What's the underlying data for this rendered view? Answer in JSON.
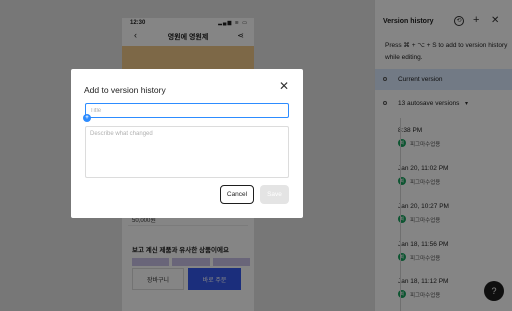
{
  "canvas": {
    "frame_label": "",
    "status_time": "12:30",
    "status_icons": "▂▄▆ ≋ ▭",
    "app_title": "영원에 영원제",
    "price": "50,000원",
    "related_heading": "보고 계신 제품과 유사한 상품이에요",
    "cart_label": "장바구니",
    "buy_label": "바로 주문",
    "colors": {
      "buy_button": "#3558ee",
      "product_image": "#f0c888"
    }
  },
  "panel": {
    "title": "Version history",
    "shortcut_hint": "Press ⌘ + ⌥ + S to add to version history while editing.",
    "current_version_label": "Current version",
    "autosave_label": "13 autosave versions",
    "versions": [
      {
        "time": "8:38 PM",
        "avatar": "피",
        "author": "피그마수업용"
      },
      {
        "time": "Jan 20, 11:02 PM",
        "avatar": "피",
        "author": "피그마수업용"
      },
      {
        "time": "Jan 20, 10:27 PM",
        "avatar": "피",
        "author": "피그마수업용"
      },
      {
        "time": "Jan 18, 11:56 PM",
        "avatar": "피",
        "author": "피그마수업용"
      },
      {
        "time": "Jan 18, 11:12 PM",
        "avatar": "피",
        "author": "피그마수업용"
      }
    ],
    "help_label": "?",
    "colors": {
      "current_row": "#dbeaff",
      "avatar": "#19a45f"
    }
  },
  "dialog": {
    "title": "Add to version history",
    "title_placeholder": "Title",
    "description_placeholder": "Describe what changed",
    "cancel_label": "Cancel",
    "save_label": "Save",
    "colors": {
      "focus_border": "#2d8cff"
    }
  }
}
